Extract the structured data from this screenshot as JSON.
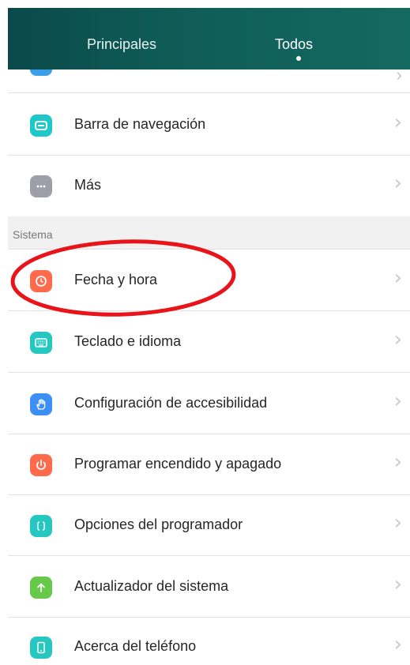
{
  "tabs": {
    "principales": "Principales",
    "todos": "Todos"
  },
  "partial_row": {
    "label": "· · · · ·",
    "icon": "blue-rounded-icon"
  },
  "rows": [
    {
      "label": "Barra de navegación",
      "icon": "navigation-bar-icon",
      "color": "#1ec8c8"
    },
    {
      "label": "Más",
      "icon": "more-dots-icon",
      "color": "#9e9ea8"
    }
  ],
  "section": {
    "label": "Sistema"
  },
  "system_rows": [
    {
      "label": "Fecha y hora",
      "icon": "clock-icon",
      "color": "#ff6a4d"
    },
    {
      "label": "Teclado e idioma",
      "icon": "keyboard-icon",
      "color": "#25c7c0"
    },
    {
      "label": "Configuración de accesibilidad",
      "icon": "hand-icon",
      "color": "#3e8ff5"
    },
    {
      "label": "Programar encendido y apagado",
      "icon": "power-schedule-icon",
      "color": "#ff6a4d"
    },
    {
      "label": "Opciones del programador",
      "icon": "code-braces-icon",
      "color": "#25c7c0"
    },
    {
      "label": "Actualizador del sistema",
      "icon": "arrow-up-icon",
      "color": "#66c94a"
    },
    {
      "label": "Acerca del teléfono",
      "icon": "phone-icon",
      "color": "#25c7c0"
    }
  ],
  "chevron": "›",
  "annotation_color": "#e8141a"
}
